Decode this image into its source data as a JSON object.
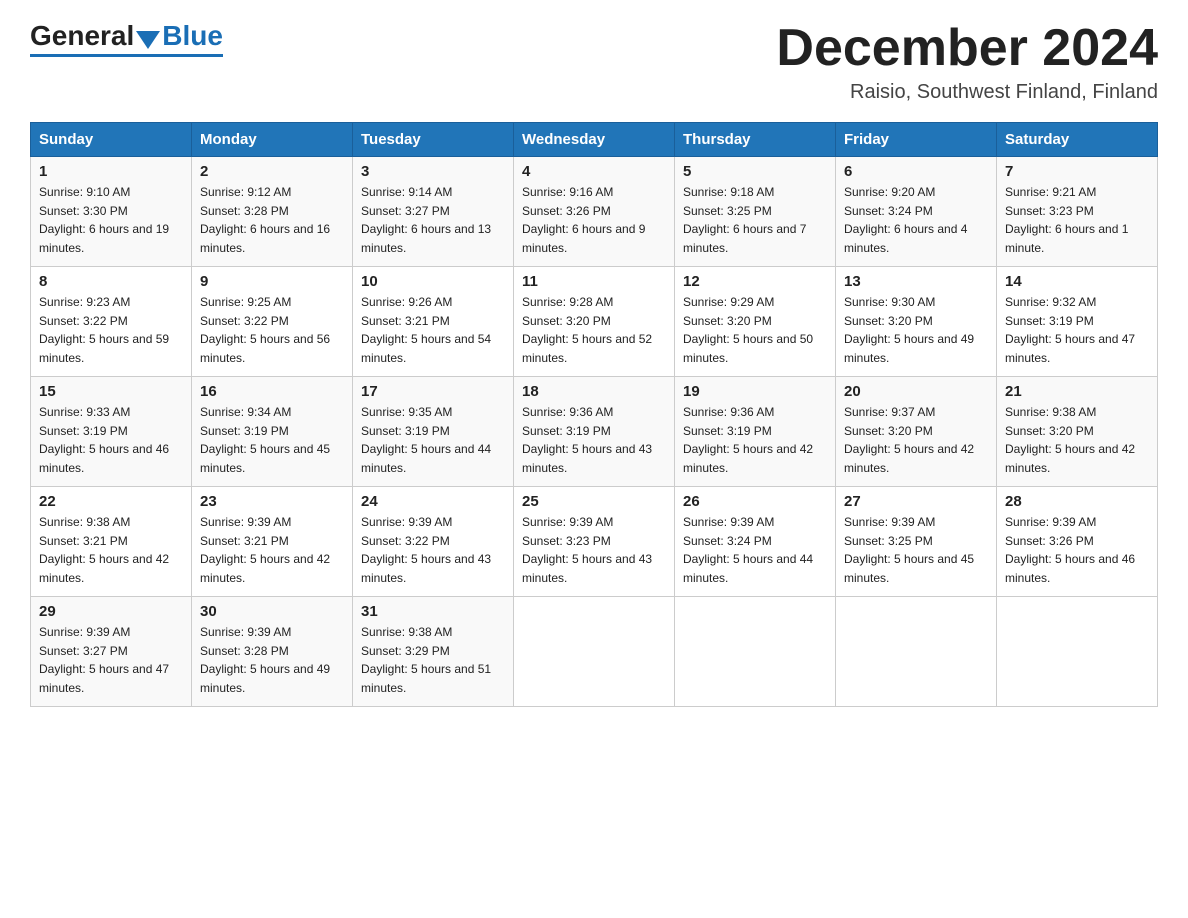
{
  "header": {
    "logo_general": "General",
    "logo_blue": "Blue",
    "month_title": "December 2024",
    "location": "Raisio, Southwest Finland, Finland"
  },
  "weekdays": [
    "Sunday",
    "Monday",
    "Tuesday",
    "Wednesday",
    "Thursday",
    "Friday",
    "Saturday"
  ],
  "weeks": [
    [
      {
        "day": "1",
        "sunrise": "9:10 AM",
        "sunset": "3:30 PM",
        "daylight": "6 hours and 19 minutes."
      },
      {
        "day": "2",
        "sunrise": "9:12 AM",
        "sunset": "3:28 PM",
        "daylight": "6 hours and 16 minutes."
      },
      {
        "day": "3",
        "sunrise": "9:14 AM",
        "sunset": "3:27 PM",
        "daylight": "6 hours and 13 minutes."
      },
      {
        "day": "4",
        "sunrise": "9:16 AM",
        "sunset": "3:26 PM",
        "daylight": "6 hours and 9 minutes."
      },
      {
        "day": "5",
        "sunrise": "9:18 AM",
        "sunset": "3:25 PM",
        "daylight": "6 hours and 7 minutes."
      },
      {
        "day": "6",
        "sunrise": "9:20 AM",
        "sunset": "3:24 PM",
        "daylight": "6 hours and 4 minutes."
      },
      {
        "day": "7",
        "sunrise": "9:21 AM",
        "sunset": "3:23 PM",
        "daylight": "6 hours and 1 minute."
      }
    ],
    [
      {
        "day": "8",
        "sunrise": "9:23 AM",
        "sunset": "3:22 PM",
        "daylight": "5 hours and 59 minutes."
      },
      {
        "day": "9",
        "sunrise": "9:25 AM",
        "sunset": "3:22 PM",
        "daylight": "5 hours and 56 minutes."
      },
      {
        "day": "10",
        "sunrise": "9:26 AM",
        "sunset": "3:21 PM",
        "daylight": "5 hours and 54 minutes."
      },
      {
        "day": "11",
        "sunrise": "9:28 AM",
        "sunset": "3:20 PM",
        "daylight": "5 hours and 52 minutes."
      },
      {
        "day": "12",
        "sunrise": "9:29 AM",
        "sunset": "3:20 PM",
        "daylight": "5 hours and 50 minutes."
      },
      {
        "day": "13",
        "sunrise": "9:30 AM",
        "sunset": "3:20 PM",
        "daylight": "5 hours and 49 minutes."
      },
      {
        "day": "14",
        "sunrise": "9:32 AM",
        "sunset": "3:19 PM",
        "daylight": "5 hours and 47 minutes."
      }
    ],
    [
      {
        "day": "15",
        "sunrise": "9:33 AM",
        "sunset": "3:19 PM",
        "daylight": "5 hours and 46 minutes."
      },
      {
        "day": "16",
        "sunrise": "9:34 AM",
        "sunset": "3:19 PM",
        "daylight": "5 hours and 45 minutes."
      },
      {
        "day": "17",
        "sunrise": "9:35 AM",
        "sunset": "3:19 PM",
        "daylight": "5 hours and 44 minutes."
      },
      {
        "day": "18",
        "sunrise": "9:36 AM",
        "sunset": "3:19 PM",
        "daylight": "5 hours and 43 minutes."
      },
      {
        "day": "19",
        "sunrise": "9:36 AM",
        "sunset": "3:19 PM",
        "daylight": "5 hours and 42 minutes."
      },
      {
        "day": "20",
        "sunrise": "9:37 AM",
        "sunset": "3:20 PM",
        "daylight": "5 hours and 42 minutes."
      },
      {
        "day": "21",
        "sunrise": "9:38 AM",
        "sunset": "3:20 PM",
        "daylight": "5 hours and 42 minutes."
      }
    ],
    [
      {
        "day": "22",
        "sunrise": "9:38 AM",
        "sunset": "3:21 PM",
        "daylight": "5 hours and 42 minutes."
      },
      {
        "day": "23",
        "sunrise": "9:39 AM",
        "sunset": "3:21 PM",
        "daylight": "5 hours and 42 minutes."
      },
      {
        "day": "24",
        "sunrise": "9:39 AM",
        "sunset": "3:22 PM",
        "daylight": "5 hours and 43 minutes."
      },
      {
        "day": "25",
        "sunrise": "9:39 AM",
        "sunset": "3:23 PM",
        "daylight": "5 hours and 43 minutes."
      },
      {
        "day": "26",
        "sunrise": "9:39 AM",
        "sunset": "3:24 PM",
        "daylight": "5 hours and 44 minutes."
      },
      {
        "day": "27",
        "sunrise": "9:39 AM",
        "sunset": "3:25 PM",
        "daylight": "5 hours and 45 minutes."
      },
      {
        "day": "28",
        "sunrise": "9:39 AM",
        "sunset": "3:26 PM",
        "daylight": "5 hours and 46 minutes."
      }
    ],
    [
      {
        "day": "29",
        "sunrise": "9:39 AM",
        "sunset": "3:27 PM",
        "daylight": "5 hours and 47 minutes."
      },
      {
        "day": "30",
        "sunrise": "9:39 AM",
        "sunset": "3:28 PM",
        "daylight": "5 hours and 49 minutes."
      },
      {
        "day": "31",
        "sunrise": "9:38 AM",
        "sunset": "3:29 PM",
        "daylight": "5 hours and 51 minutes."
      },
      null,
      null,
      null,
      null
    ]
  ]
}
